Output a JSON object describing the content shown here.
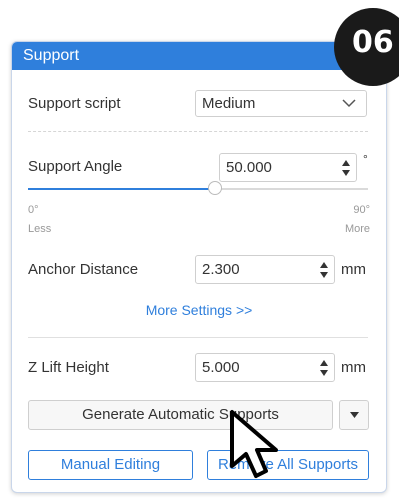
{
  "badge": {
    "text": "06"
  },
  "panel": {
    "title": "Support",
    "support_script": {
      "label": "Support script",
      "value": "Medium"
    },
    "support_angle": {
      "label": "Support Angle",
      "value": "50.000",
      "unit": "°",
      "slider_fraction": 0.55,
      "min_label": "0°",
      "min_caption": "Less",
      "max_label": "90°",
      "max_caption": "More"
    },
    "anchor_distance": {
      "label": "Anchor Distance",
      "value": "2.300",
      "unit": "mm"
    },
    "more_settings": "More Settings >>",
    "z_lift": {
      "label": "Z Lift Height",
      "value": "5.000",
      "unit": "mm"
    },
    "generate_button": "Generate Automatic Supports",
    "manual_button": "Manual Editing",
    "remove_button": "Remove All Supports"
  },
  "colors": {
    "accent": "#2f7fdc",
    "badge": "#1a1a1a"
  },
  "icons": [
    "chevron-down-icon",
    "spinner-up-icon",
    "spinner-down-icon",
    "dropdown-arrow-icon",
    "mouse-cursor-icon"
  ]
}
